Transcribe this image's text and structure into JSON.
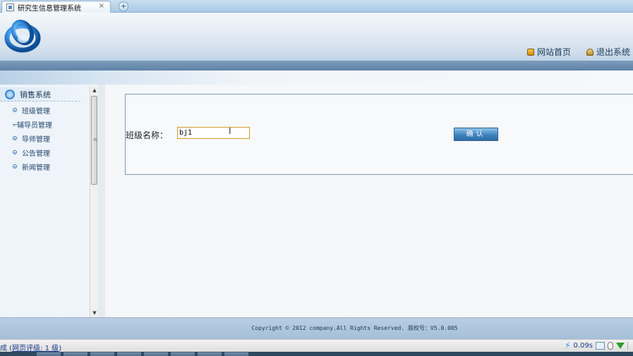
{
  "browser": {
    "tab_title": "研究生信息管理系统",
    "tab_close": "×",
    "new_tab": "+"
  },
  "header": {
    "links": [
      {
        "label": "网站首页",
        "icon": "home-icon"
      },
      {
        "label": "退出系统",
        "icon": "exit-icon"
      }
    ]
  },
  "sidebar": {
    "title": "销售系统",
    "items": [
      {
        "label": "班级管理"
      },
      {
        "label": "辅导员管理"
      },
      {
        "label": "导师管理"
      },
      {
        "label": "公告管理"
      },
      {
        "label": "新闻管理"
      }
    ]
  },
  "form": {
    "label": "班级名称：",
    "input_value": "bj1",
    "submit_label": "确认"
  },
  "footer": {
    "copyright": "Copyright © 2012 company.All Rights Reserved. 版权号：V5.0.005"
  },
  "statusbar": {
    "left_prefix": "成 (",
    "rating_link": "网页评级: 1 级",
    "left_suffix": ")",
    "load_time": "0.09s"
  },
  "colors": {
    "accent": "#3d82be",
    "header_band": "#6b8db0",
    "input_border": "#d49a2a"
  }
}
